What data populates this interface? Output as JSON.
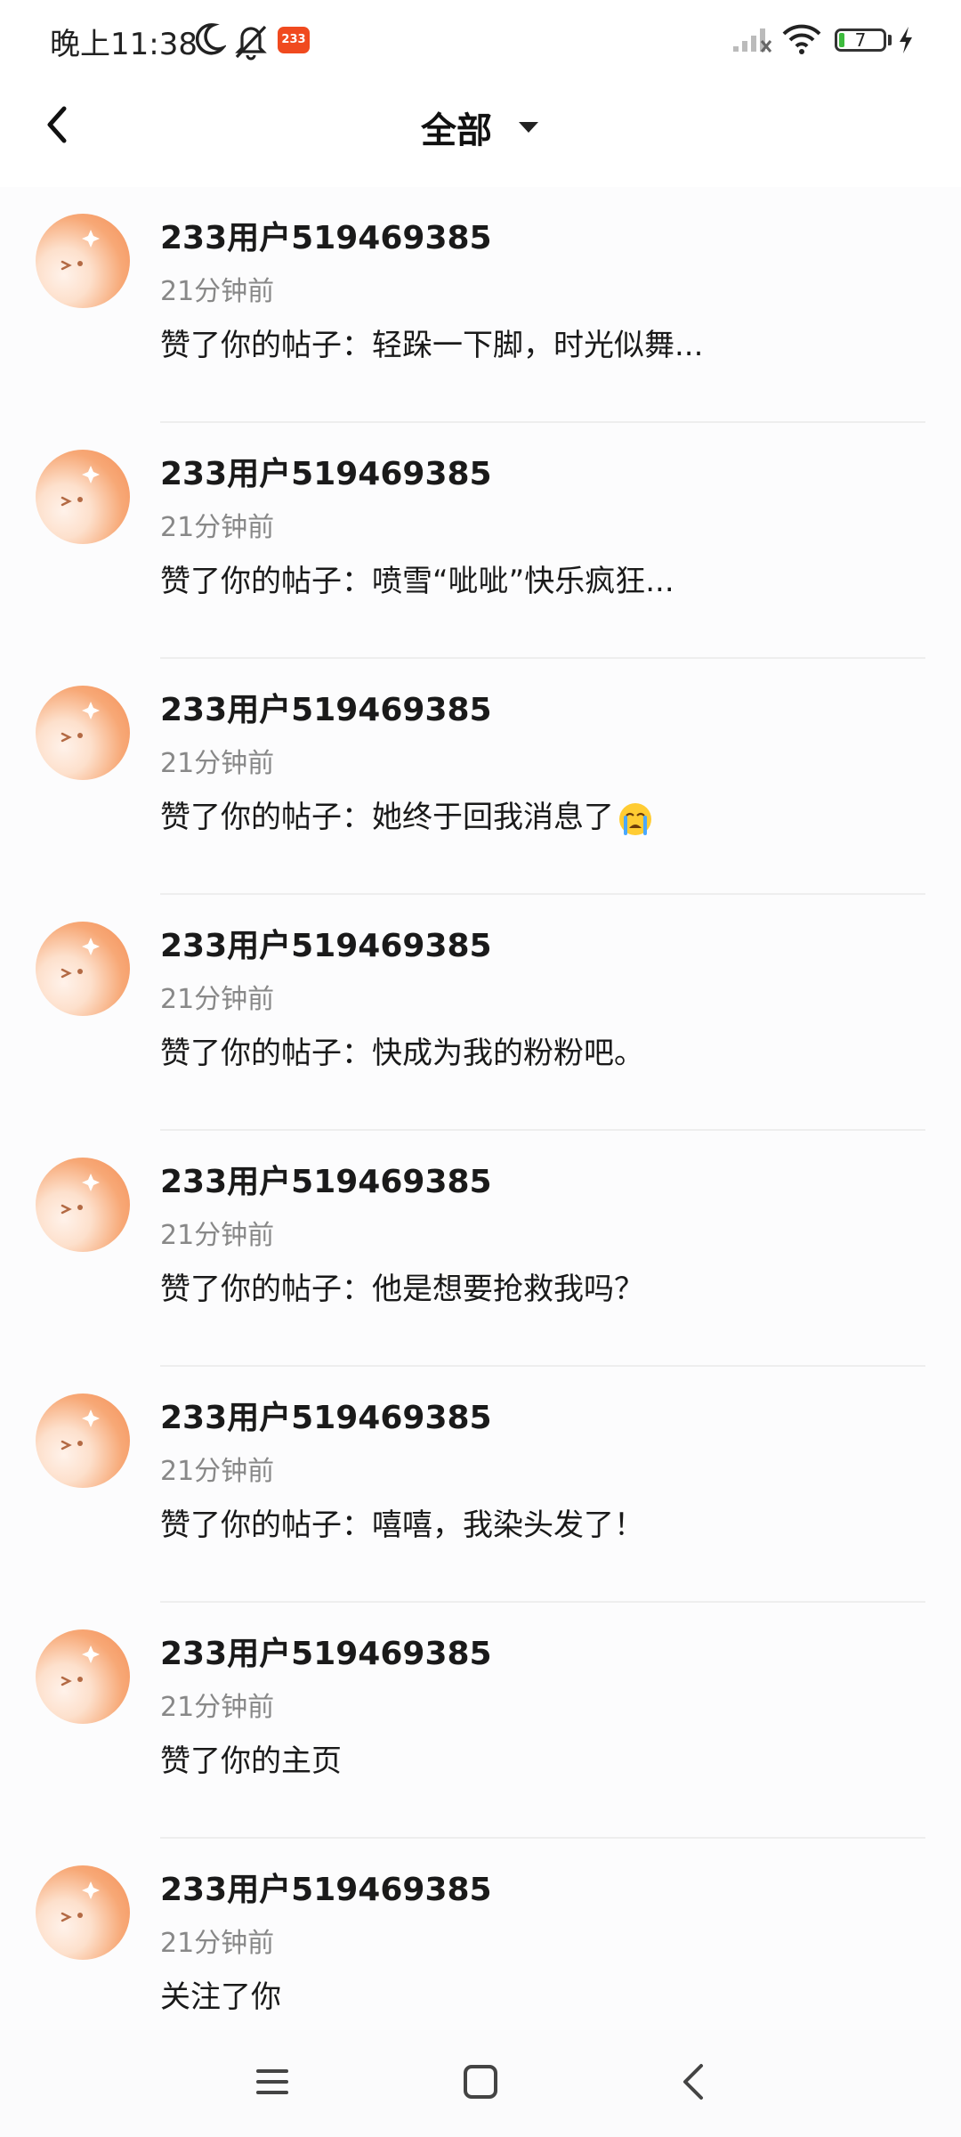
{
  "status_bar": {
    "time": "晚上11:38",
    "app_badge": "233",
    "battery": "7",
    "icons": [
      "moon-icon",
      "bell-off-icon",
      "signal-icon",
      "wifi-icon",
      "battery-icon",
      "charging-icon"
    ]
  },
  "header": {
    "title": "全部",
    "back_icon": "chevron-left-icon",
    "dropdown_icon": "caret-down-icon"
  },
  "notifications": [
    {
      "username": "233用户519469385",
      "time": "21分钟前",
      "text": "赞了你的帖子：轻跺一下脚，时光似舞..."
    },
    {
      "username": "233用户519469385",
      "time": "21分钟前",
      "text": "赞了你的帖子：喷雪“呲呲”快乐疯狂..."
    },
    {
      "username": "233用户519469385",
      "time": "21分钟前",
      "text": "赞了你的帖子：她终于回我消息了",
      "emoji": "crying-face-icon"
    },
    {
      "username": "233用户519469385",
      "time": "21分钟前",
      "text": "赞了你的帖子：快成为我的粉粉吧。"
    },
    {
      "username": "233用户519469385",
      "time": "21分钟前",
      "text": "赞了你的帖子：他是想要抢救我吗？"
    },
    {
      "username": "233用户519469385",
      "time": "21分钟前",
      "text": "赞了你的帖子：嘻嘻，我染头发了！"
    },
    {
      "username": "233用户519469385",
      "time": "21分钟前",
      "text": "赞了你的主页"
    },
    {
      "username": "233用户519469385",
      "time": "21分钟前",
      "text": "关注了你"
    }
  ],
  "nav_bar": {
    "icons": [
      "menu-icon",
      "home-square-icon",
      "back-triangle-icon"
    ]
  },
  "colors": {
    "avatar_orange": "#f58f58",
    "badge_red": "#f04a1f",
    "secondary_text": "#888888"
  }
}
